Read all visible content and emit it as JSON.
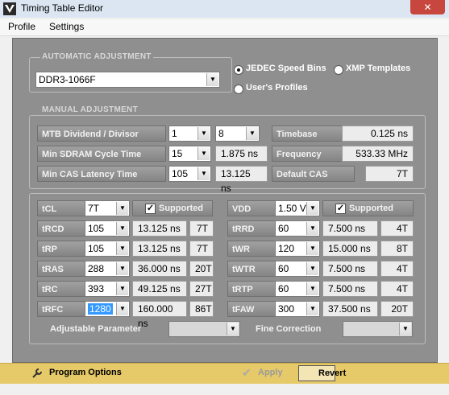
{
  "window": {
    "title": "Timing Table Editor",
    "close_glyph": "✕"
  },
  "menu": {
    "items": [
      "Profile",
      "Settings"
    ]
  },
  "auto": {
    "legend": "AUTOMATIC ADJUSTMENT",
    "profile_value": "DDR3-1066F",
    "radios": [
      {
        "label": "JEDEC Speed Bins",
        "checked": true
      },
      {
        "label": "XMP Templates",
        "checked": false
      },
      {
        "label": "User's Profiles",
        "checked": false
      }
    ]
  },
  "manual": {
    "legend": "MANUAL ADJUSTMENT",
    "mtb_label": "MTB Dividend / Divisor",
    "mtb_dividend": "1",
    "mtb_divisor": "8",
    "timebase_label": "Timebase",
    "timebase_value": "0.125 ns",
    "cycle_label": "Min SDRAM Cycle Time",
    "cycle_select": "15",
    "cycle_value": "1.875 ns",
    "frequency_label": "Frequency",
    "frequency_value": "533.33 MHz",
    "cas_label": "Min CAS Latency Time",
    "cas_select": "105",
    "cas_value": "13.125 ns",
    "default_cas_label": "Default CAS",
    "default_cas_value": "7T"
  },
  "timings": {
    "tcl_label": "tCL",
    "tcl_value": "7T",
    "supported_label": "Supported",
    "vdd_label": "VDD",
    "vdd_value": "1.50 V",
    "vdd_supported_label": "Supported",
    "left": [
      {
        "label": "tRCD",
        "sel": "105",
        "ns": "13.125 ns",
        "t": "7T"
      },
      {
        "label": "tRP",
        "sel": "105",
        "ns": "13.125 ns",
        "t": "7T"
      },
      {
        "label": "tRAS",
        "sel": "288",
        "ns": "36.000 ns",
        "t": "20T"
      },
      {
        "label": "tRC",
        "sel": "393",
        "ns": "49.125 ns",
        "t": "27T"
      },
      {
        "label": "tRFC",
        "sel": "1280",
        "ns": "160.000 ns",
        "t": "86T"
      }
    ],
    "right": [
      {
        "label": "tRRD",
        "sel": "60",
        "ns": "7.500 ns",
        "t": "4T"
      },
      {
        "label": "tWR",
        "sel": "120",
        "ns": "15.000 ns",
        "t": "8T"
      },
      {
        "label": "tWTR",
        "sel": "60",
        "ns": "7.500 ns",
        "t": "4T"
      },
      {
        "label": "tRTP",
        "sel": "60",
        "ns": "7.500 ns",
        "t": "4T"
      },
      {
        "label": "tFAW",
        "sel": "300",
        "ns": "37.500 ns",
        "t": "20T"
      }
    ],
    "adjustable_label": "Adjustable Parameter",
    "fine_label": "Fine Correction"
  },
  "footer": {
    "program_options_label": "Program Options",
    "apply_label": "Apply",
    "revert_label": "Revert"
  },
  "colors": {
    "panel": "#8f8f8f",
    "footer": "#e6c968",
    "close": "#c7463d",
    "highlight": "#3399ff"
  },
  "icons": [
    "app-logo-icon",
    "close-icon",
    "chevron-down-icon",
    "check-icon",
    "wrench-icon",
    "apply-check-icon"
  ]
}
